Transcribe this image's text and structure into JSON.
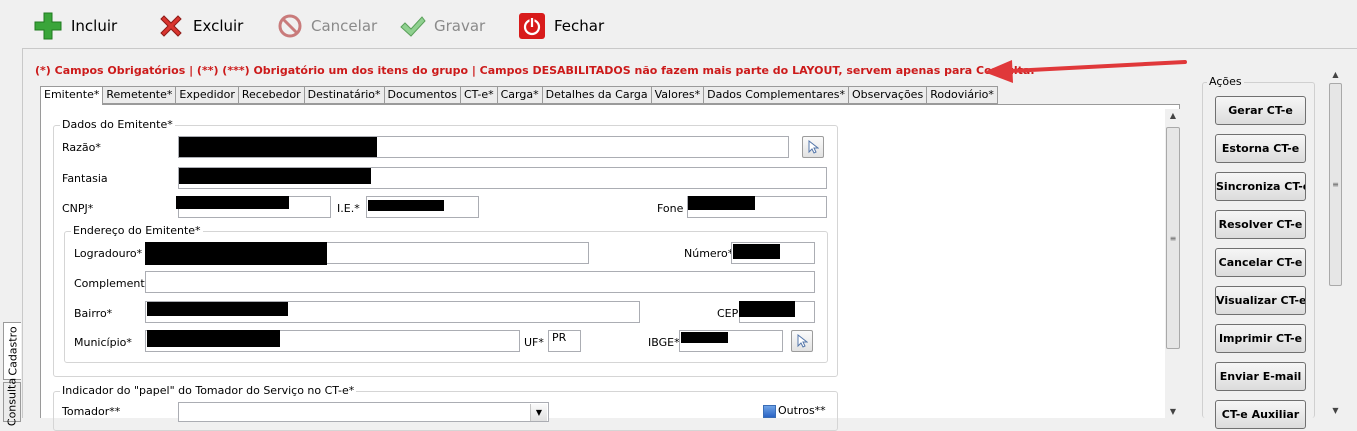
{
  "toolbar": {
    "incluir": "Incluir",
    "excluir": "Excluir",
    "cancelar": "Cancelar",
    "gravar": "Gravar",
    "fechar": "Fechar"
  },
  "warning": "(*) Campos Obrigatórios   |   (**) (***) Obrigatório um dos itens do grupo   | Campos DESABILITADOS não fazem mais parte do LAYOUT, servem apenas para Consulta.",
  "tabs": [
    "Emitente*",
    "Remetente*",
    "Expedidor",
    "Recebedor",
    "Destinatário*",
    "Documentos",
    "CT-e*",
    "Carga*",
    "Detalhes da Carga",
    "Valores*",
    "Dados Complementares*",
    "Observações",
    "Rodoviário*"
  ],
  "emitente": {
    "legend": "Dados do Emitente*",
    "razao_label": "Razão*",
    "fantasia_label": "Fantasia",
    "cnpj_label": "CNPJ*",
    "ie_label": "I.E.*",
    "fone_label": "Fone"
  },
  "endereco": {
    "legend": "Endereço do Emitente*",
    "logradouro_label": "Logradouro*",
    "numero_label": "Número*",
    "complemento_label": "Complemento",
    "bairro_label": "Bairro*",
    "cep_label": "CEP",
    "municipio_label": "Município*",
    "uf_label": "UF*",
    "uf_value": "PR",
    "ibge_label": "IBGE*"
  },
  "tomador": {
    "legend": "Indicador do \"papel\" do Tomador do Serviço no CT-e*",
    "tomador_label": "Tomador**",
    "outros_label": "Outros**"
  },
  "acoes": {
    "legend": "Ações",
    "buttons": [
      "Gerar CT-e",
      "Estorna CT-e",
      "Sincroniza CT-e",
      "Resolver CT-e",
      "Cancelar CT-e",
      "Visualizar CT-e",
      "Imprimir CT-e",
      "Enviar E-mail",
      "CT-e Auxiliar"
    ]
  },
  "sidetabs": {
    "cadastro": "Cadastro",
    "consulta": "Consulta"
  },
  "colors": {
    "warning": "#cc1a1a",
    "arrow": "#e0383a"
  }
}
